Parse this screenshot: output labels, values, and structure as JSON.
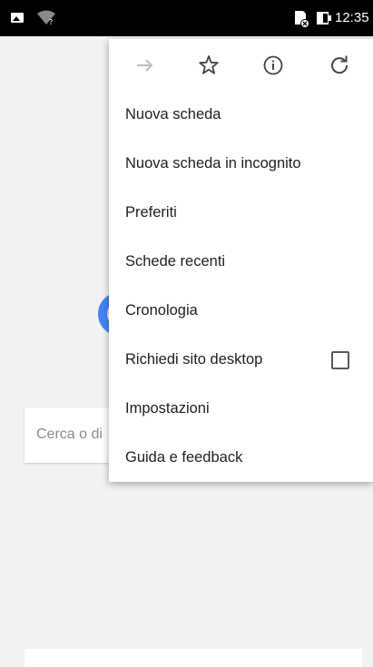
{
  "status_bar": {
    "time": "12:35",
    "icons": [
      "gallery-icon",
      "wifi-question-icon",
      "sim-card-error-icon",
      "battery-icon"
    ]
  },
  "page": {
    "search_placeholder": "Cerca o di"
  },
  "menu": {
    "toolbar_icons": [
      "forward-icon",
      "bookmark-star-icon",
      "info-icon",
      "reload-icon"
    ],
    "items": [
      {
        "label": "Nuova scheda"
      },
      {
        "label": "Nuova scheda in incognito"
      },
      {
        "label": "Preferiti"
      },
      {
        "label": "Schede recenti"
      },
      {
        "label": "Cronologia"
      },
      {
        "label": "Richiedi sito desktop",
        "checkbox_checked": false
      },
      {
        "label": "Impostazioni"
      },
      {
        "label": "Guida e feedback"
      }
    ]
  },
  "colors": {
    "status_bar": "#000000",
    "page_background": "#f2f2f2",
    "menu_background": "#ffffff",
    "logo_blue": "#4285f4"
  }
}
